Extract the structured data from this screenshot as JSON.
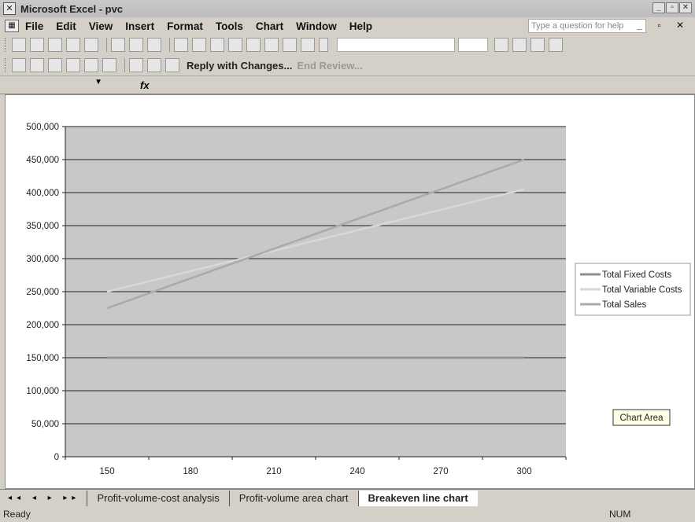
{
  "window": {
    "title": "Microsoft Excel - pvc",
    "controls": [
      "_",
      "▫",
      "✕"
    ]
  },
  "menu": {
    "items": [
      {
        "label": "File"
      },
      {
        "label": "Edit"
      },
      {
        "label": "View"
      },
      {
        "label": "Insert"
      },
      {
        "label": "Format"
      },
      {
        "label": "Tools"
      },
      {
        "label": "Chart"
      },
      {
        "label": "Window"
      },
      {
        "label": "Help"
      }
    ],
    "ask_placeholder": "Type a question for help",
    "doc_controls": "_ ▫ ✕"
  },
  "toolbar2": {
    "reply_label": "Reply with Changes...",
    "end_review_label": "End Review..."
  },
  "formula": {
    "fx_label": "fx"
  },
  "chart_data": {
    "type": "line",
    "x": [
      150,
      180,
      210,
      240,
      270,
      300
    ],
    "ylim": [
      0,
      500000
    ],
    "yticks": [
      "0",
      "50,000",
      "100,000",
      "150,000",
      "200,000",
      "250,000",
      "300,000",
      "350,000",
      "400,000",
      "450,000",
      "500,000"
    ],
    "xticks": [
      "150",
      "180",
      "210",
      "240",
      "270",
      "300"
    ],
    "series": [
      {
        "name": "Total Fixed Costs",
        "values": [
          150000,
          150000,
          150000,
          150000,
          150000,
          150000
        ],
        "color": "#8f8f8f"
      },
      {
        "name": "Total Variable Costs",
        "values": [
          250000,
          281000,
          312000,
          343000,
          374000,
          405000
        ],
        "color": "#d8d8d8"
      },
      {
        "name": "Total Sales",
        "values": [
          225000,
          270000,
          315000,
          360000,
          405000,
          450000
        ],
        "color": "#aaaaaa"
      }
    ],
    "legend_position": "right",
    "grid": true,
    "annotation": "Chart Area"
  },
  "sheet_tabs": {
    "tabs": [
      {
        "label": "Profit-volume-cost analysis",
        "active": false
      },
      {
        "label": "Profit-volume area chart",
        "active": false
      },
      {
        "label": "Breakeven line chart",
        "active": true
      }
    ]
  },
  "status": {
    "ready": "Ready",
    "num": "NUM"
  }
}
